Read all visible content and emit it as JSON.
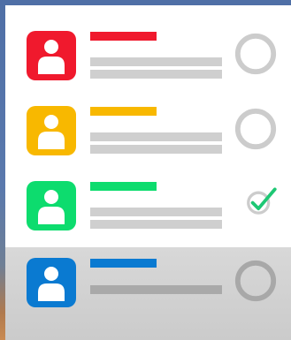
{
  "colors": {
    "red": "#f0192d",
    "yellow": "#f8b800",
    "green": "#0ddc6e",
    "blue": "#0a7ad1",
    "ring": "#cccccc",
    "check": "#1ec774"
  },
  "rows": [
    {
      "id": "red",
      "avatar_icon": "user-icon",
      "status": "unchecked"
    },
    {
      "id": "yellow",
      "avatar_icon": "user-icon",
      "status": "unchecked"
    },
    {
      "id": "green",
      "avatar_icon": "user-icon",
      "status": "checked"
    },
    {
      "id": "blue",
      "avatar_icon": "user-icon",
      "status": "unchecked"
    }
  ]
}
